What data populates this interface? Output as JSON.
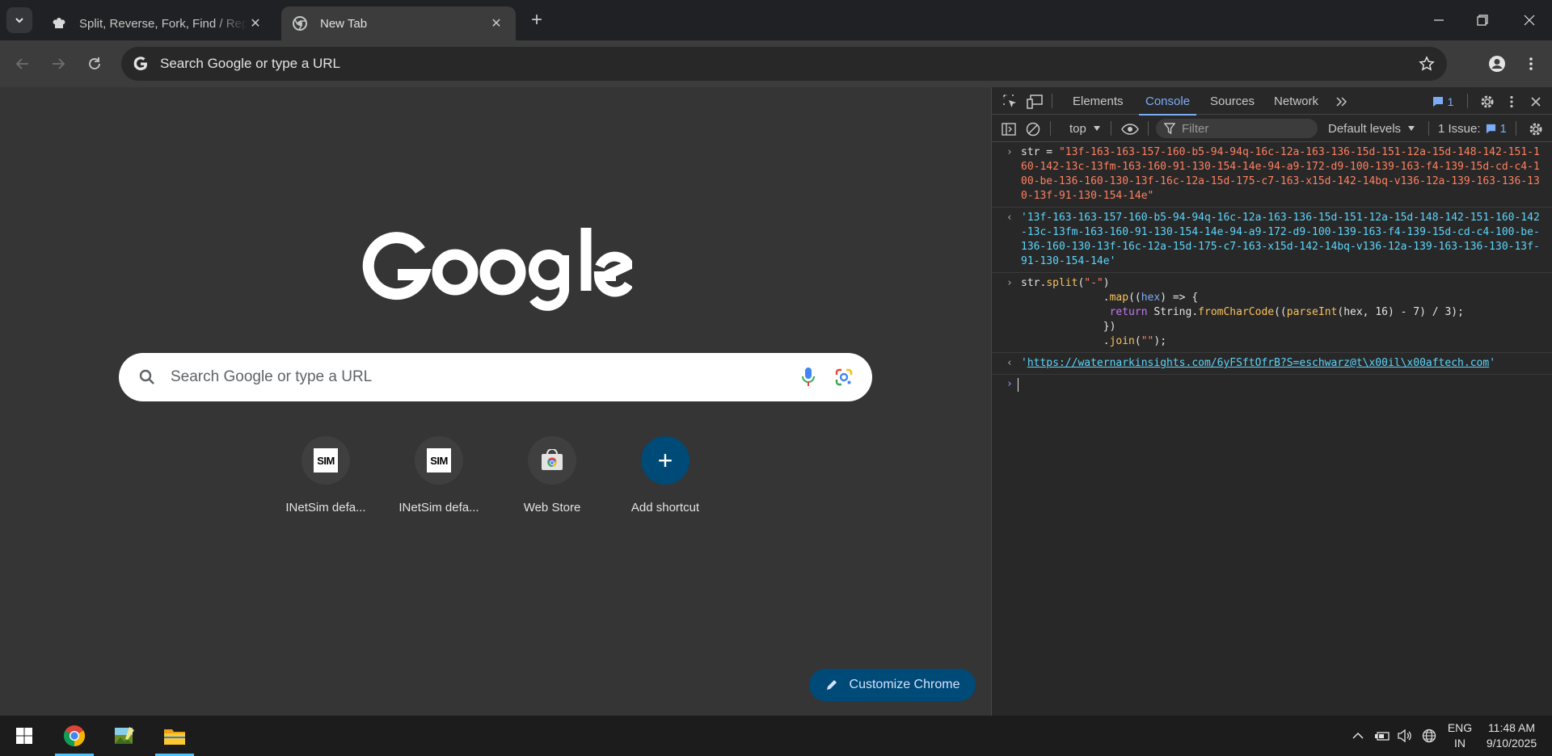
{
  "browser": {
    "tabs": [
      {
        "title": "Split, Reverse, Fork, Find / Replace",
        "close": "✕"
      },
      {
        "title": "New Tab",
        "close": "✕"
      }
    ],
    "new_tab_symbol": "+",
    "omnibox_text": "Search Google or type a URL"
  },
  "ntp": {
    "search_placeholder": "Search Google or type a URL",
    "shortcuts": [
      {
        "label": "INetSim defa...",
        "tile": "SIM"
      },
      {
        "label": "INetSim defa...",
        "tile": "SIM"
      },
      {
        "label": "Web Store"
      },
      {
        "label": "Add shortcut",
        "symbol": "+"
      }
    ],
    "customize_label": "Customize Chrome"
  },
  "devtools": {
    "tabs": [
      "Elements",
      "Console",
      "Sources",
      "Network"
    ],
    "active_tab": "Console",
    "message_count": "1",
    "context": "top",
    "filter_placeholder": "Filter",
    "levels": "Default levels",
    "issues_label": "1 Issue:",
    "issues_count": "1",
    "console": {
      "input1_prefix": "str = ",
      "input1_string": "\"13f-163-163-157-160-b5-94-94q-16c-12a-163-136-15d-151-12a-15d-148-142-151-160-142-13c-13fm-163-160-91-130-154-14e-94-a9-172-d9-100-139-163-f4-139-15d-cd-c4-100-be-136-160-130-13f-16c-12a-15d-175-c7-163-x15d-142-14bq-v136-12a-139-163-136-130-13f-91-130-154-14e\"",
      "output1": "'13f-163-163-157-160-b5-94-94q-16c-12a-163-136-15d-151-12a-15d-148-142-151-160-142-13c-13fm-163-160-91-130-154-14e-94-a9-172-d9-100-139-163-f4-139-15d-cd-c4-100-be-136-160-130-13f-16c-12a-15d-175-c7-163-x15d-142-14bq-v136-12a-139-163-136-130-13f-91-130-154-14e'",
      "input2": {
        "l1_obj": "str",
        "l1_method": "split",
        "l1_arg": "\"-\"",
        "l2_method": "map",
        "l2_param": "hex",
        "l3_kw": "return",
        "l3_obj": "String",
        "l3_method": "fromCharCode",
        "l3_fn": "parseInt",
        "l3_args": "hex, 16",
        "l3_rest": " - 7) / 3);",
        "l4": "})",
        "l5_method": "join",
        "l5_arg": "\"\""
      },
      "output2_url": "https://waternarkinsights.com/6yFSftOfrB?S=eschwarz@t\\x00il\\x00aftech.com"
    }
  },
  "taskbar": {
    "lang_top": "ENG",
    "lang_bottom": "IN",
    "time": "11:48 AM",
    "date": "9/10/2025"
  }
}
